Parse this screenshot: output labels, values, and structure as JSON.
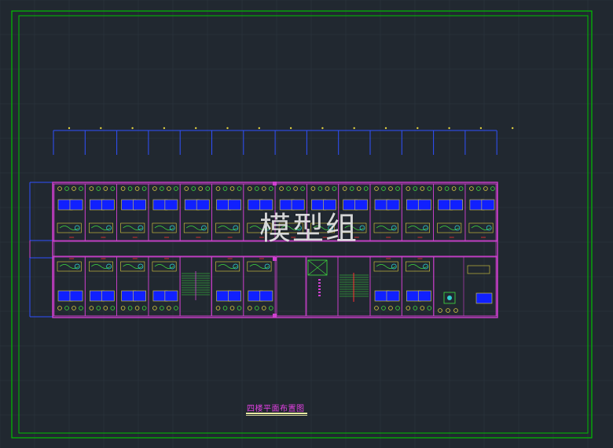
{
  "drawing": {
    "title": "四楼平面布置图",
    "watermark": "模型组"
  },
  "colors": {
    "background": "#212830",
    "grid": "#2c3640",
    "frame": "#00c000",
    "wall": "#d040d0",
    "axis": "#3050ff",
    "furniture_yellow": "#e0d040",
    "furniture_green": "#40e040",
    "furniture_cyan": "#30d0d0",
    "bed_blue": "#1020ff",
    "red": "#ff3030"
  }
}
